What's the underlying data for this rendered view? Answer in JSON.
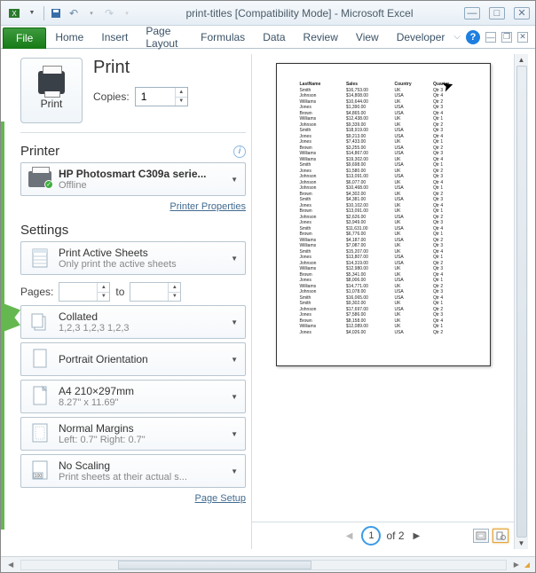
{
  "titlebar": {
    "title": "print-titles  [Compatibility Mode]  -  Microsoft Excel"
  },
  "tabs": {
    "file": "File",
    "items": [
      "Home",
      "Insert",
      "Page Layout",
      "Formulas",
      "Data",
      "Review",
      "View",
      "Developer"
    ]
  },
  "print": {
    "heading": "Print",
    "button_label": "Print",
    "copies_label": "Copies:",
    "copies_value": "1"
  },
  "printer": {
    "heading": "Printer",
    "name": "HP Photosmart C309a serie...",
    "status": "Offline",
    "properties_link": "Printer Properties"
  },
  "settings": {
    "heading": "Settings",
    "what": {
      "title": "Print Active Sheets",
      "sub": "Only print the active sheets"
    },
    "pages_label": "Pages:",
    "pages_to": "to",
    "collate": {
      "title": "Collated",
      "sub": "1,2,3   1,2,3   1,2,3"
    },
    "orientation": {
      "title": "Portrait Orientation"
    },
    "size": {
      "title": "A4 210×297mm",
      "sub": "8.27\" x 11.69\""
    },
    "margins": {
      "title": "Normal Margins",
      "sub": "Left:  0.7\"    Right:  0.7\""
    },
    "scaling": {
      "title": "No Scaling",
      "sub": "Print sheets at their actual s..."
    },
    "page_setup_link": "Page Setup"
  },
  "preview": {
    "headers": [
      "LastName",
      "Sales",
      "Country",
      "Quarter"
    ],
    "rows": [
      [
        "Smith",
        "$16,753.00",
        "UK",
        "Qtr 3"
      ],
      [
        "Johnson",
        "$14,808.00",
        "USA",
        "Qtr 4"
      ],
      [
        "Williams",
        "$10,644.00",
        "UK",
        "Qtr 2"
      ],
      [
        "Jones",
        "$1,390.00",
        "USA",
        "Qtr 3"
      ],
      [
        "Brown",
        "$4,865.00",
        "USA",
        "Qtr 4"
      ],
      [
        "Williams",
        "$12,438.00",
        "UK",
        "Qtr 1"
      ],
      [
        "Johnson",
        "$9,339.00",
        "UK",
        "Qtr 2"
      ],
      [
        "Smith",
        "$18,919.00",
        "USA",
        "Qtr 3"
      ],
      [
        "Jones",
        "$9,213.00",
        "USA",
        "Qtr 4"
      ],
      [
        "Jones",
        "$7,433.00",
        "UK",
        "Qtr 1"
      ],
      [
        "Brown",
        "$3,255.00",
        "USA",
        "Qtr 2"
      ],
      [
        "Williams",
        "$14,867.00",
        "USA",
        "Qtr 3"
      ],
      [
        "Williams",
        "$19,302.00",
        "UK",
        "Qtr 4"
      ],
      [
        "Smith",
        "$9,698.00",
        "USA",
        "Qtr 1"
      ],
      [
        "Jones",
        "$1,580.00",
        "UK",
        "Qtr 2"
      ],
      [
        "Johnson",
        "$13,091.00",
        "USA",
        "Qtr 3"
      ],
      [
        "Johnson",
        "$6,077.00",
        "UK",
        "Qtr 4"
      ],
      [
        "Johnson",
        "$10,468.00",
        "USA",
        "Qtr 1"
      ],
      [
        "Brown",
        "$4,302.00",
        "UK",
        "Qtr 2"
      ],
      [
        "Smith",
        "$4,381.00",
        "USA",
        "Qtr 3"
      ],
      [
        "Jones",
        "$10,102.00",
        "UK",
        "Qtr 4"
      ],
      [
        "Brown",
        "$13,091.00",
        "UK",
        "Qtr 1"
      ],
      [
        "Johnson",
        "$2,626.00",
        "USA",
        "Qtr 2"
      ],
      [
        "Jones",
        "$3,949.00",
        "UK",
        "Qtr 3"
      ],
      [
        "Smith",
        "$11,631.00",
        "USA",
        "Qtr 4"
      ],
      [
        "Brown",
        "$6,776.00",
        "UK",
        "Qtr 1"
      ],
      [
        "Williams",
        "$4,187.00",
        "USA",
        "Qtr 2"
      ],
      [
        "Williams",
        "$7,087.00",
        "UK",
        "Qtr 3"
      ],
      [
        "Smith",
        "$15,207.00",
        "UK",
        "Qtr 4"
      ],
      [
        "Jones",
        "$13,807.00",
        "USA",
        "Qtr 1"
      ],
      [
        "Johnson",
        "$14,319.00",
        "USA",
        "Qtr 2"
      ],
      [
        "Williams",
        "$12,980.00",
        "UK",
        "Qtr 3"
      ],
      [
        "Brown",
        "$5,341.00",
        "UK",
        "Qtr 4"
      ],
      [
        "Jones",
        "$8,006.00",
        "USA",
        "Qtr 1"
      ],
      [
        "Williams",
        "$14,771.00",
        "UK",
        "Qtr 2"
      ],
      [
        "Johnson",
        "$1,078.00",
        "USA",
        "Qtr 3"
      ],
      [
        "Smith",
        "$16,065.00",
        "USA",
        "Qtr 4"
      ],
      [
        "Smith",
        "$9,302.00",
        "UK",
        "Qtr 1"
      ],
      [
        "Johnson",
        "$17,697.00",
        "USA",
        "Qtr 2"
      ],
      [
        "Jones",
        "$7,586.00",
        "UK",
        "Qtr 3"
      ],
      [
        "Brown",
        "$8,158.00",
        "UK",
        "Qtr 4"
      ],
      [
        "Williams",
        "$12,089.00",
        "UK",
        "Qtr 1"
      ],
      [
        "Jones",
        "$4,026.00",
        "USA",
        "Qtr 2"
      ]
    ]
  },
  "navigation": {
    "current": "1",
    "of_text": "of 2"
  }
}
